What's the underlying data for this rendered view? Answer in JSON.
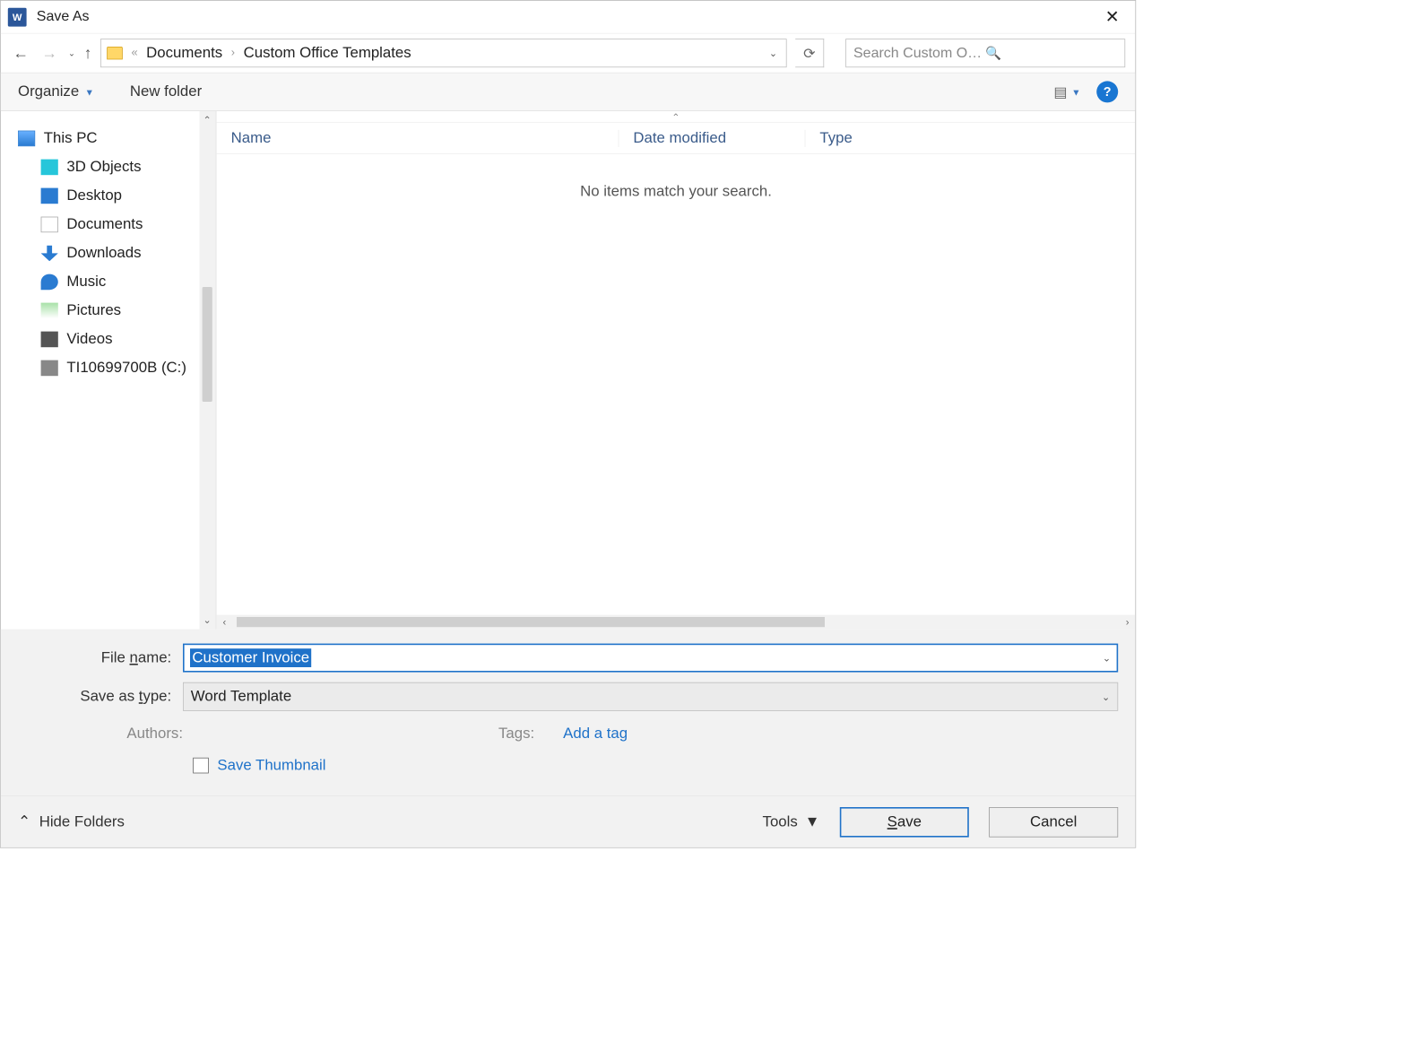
{
  "window": {
    "title": "Save As"
  },
  "breadcrumb": {
    "prefix": "«",
    "parts": [
      "Documents",
      "Custom Office Templates"
    ]
  },
  "search": {
    "placeholder": "Search Custom Office Templa..."
  },
  "toolbar": {
    "organize_label": "Organize",
    "new_folder_label": "New folder"
  },
  "sidebar": {
    "root": "This PC",
    "items": [
      {
        "label": "3D Objects",
        "icon": "ic-3d"
      },
      {
        "label": "Desktop",
        "icon": "ic-desktop"
      },
      {
        "label": "Documents",
        "icon": "ic-doc"
      },
      {
        "label": "Downloads",
        "icon": "ic-down"
      },
      {
        "label": "Music",
        "icon": "ic-music"
      },
      {
        "label": "Pictures",
        "icon": "ic-pic"
      },
      {
        "label": "Videos",
        "icon": "ic-video"
      },
      {
        "label": "TI10699700B (C:)",
        "icon": "ic-drive",
        "has_caret": true
      }
    ]
  },
  "columns": {
    "name": "Name",
    "date": "Date modified",
    "type": "Type"
  },
  "empty_message": "No items match your search.",
  "form": {
    "filename_label_pre": "File ",
    "filename_label_ul": "n",
    "filename_label_post": "ame:",
    "filename_value": "Customer Invoice",
    "type_label_pre": "Save as ",
    "type_label_ul": "t",
    "type_label_post": "ype:",
    "type_value": "Word Template",
    "authors_label": "Authors:",
    "tags_label": "Tags:",
    "tags_action": "Add a tag",
    "thumbnail_label": "Save Thumbnail"
  },
  "footer": {
    "hide_folders": "Hide Folders",
    "tools_label_pre": "Too",
    "tools_label_ul": "l",
    "tools_label_post": "s",
    "save_ul": "S",
    "save_post": "ave",
    "cancel": "Cancel"
  }
}
